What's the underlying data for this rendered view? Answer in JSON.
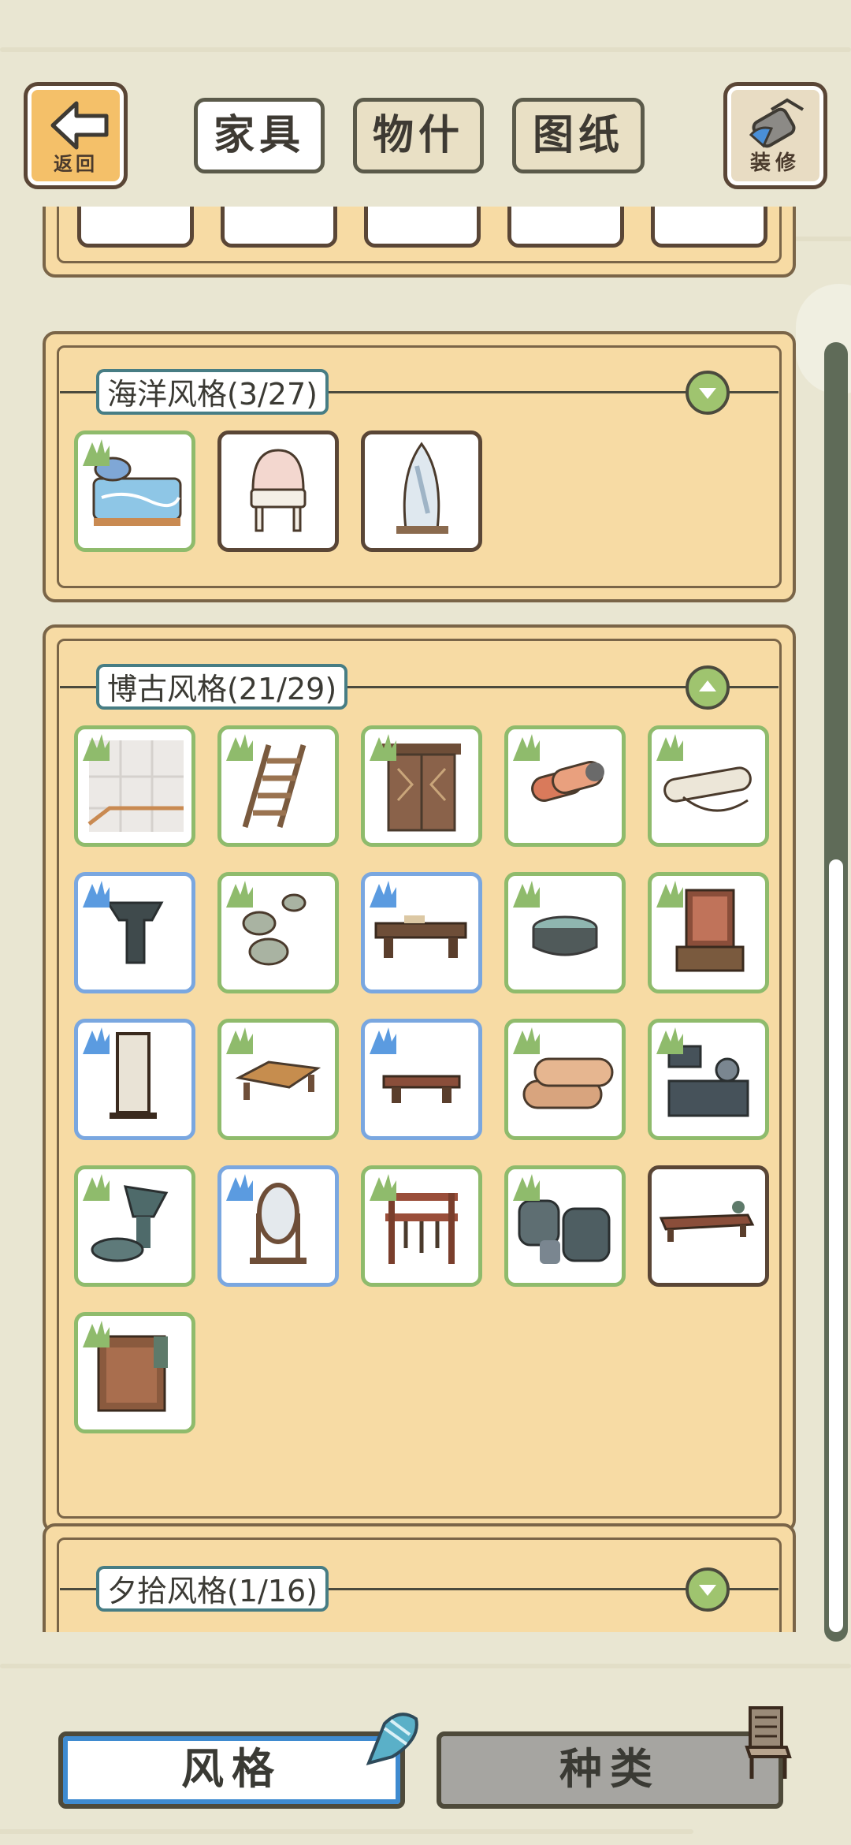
{
  "header": {
    "back_label": "返回",
    "tabs": [
      {
        "label": "家具",
        "state": "active"
      },
      {
        "label": "物什",
        "state": "inactive"
      },
      {
        "label": "图纸",
        "state": "inactive"
      }
    ],
    "decorate_label": "装修"
  },
  "sections": [
    {
      "title": "海洋风格(3/27)",
      "expanded": false,
      "items": [
        {
          "icon": "sea-bed-icon",
          "border": "green",
          "hand": true
        },
        {
          "icon": "shell-chair-icon",
          "border": "brown",
          "hand": false
        },
        {
          "icon": "surfboard-mirror-icon",
          "border": "brown",
          "hand": false
        }
      ]
    },
    {
      "title": "博古风格(21/29)",
      "expanded": true,
      "items": [
        {
          "icon": "tile-floor-icon",
          "border": "green",
          "hand": true
        },
        {
          "icon": "ladder-icon",
          "border": "green",
          "hand": true
        },
        {
          "icon": "wooden-door-icon",
          "border": "green",
          "hand": true
        },
        {
          "icon": "rolled-mat-icon",
          "border": "green",
          "hand": true
        },
        {
          "icon": "scroll-icon",
          "border": "green",
          "hand": true
        },
        {
          "icon": "stand-icon",
          "border": "blue",
          "hand": true
        },
        {
          "icon": "stepping-stones-icon",
          "border": "green",
          "hand": true
        },
        {
          "icon": "low-desk-icon",
          "border": "blue",
          "hand": true
        },
        {
          "icon": "basin-icon",
          "border": "green",
          "hand": true
        },
        {
          "icon": "cabinet-icon",
          "border": "green",
          "hand": true
        },
        {
          "icon": "screen-icon",
          "border": "blue",
          "hand": true
        },
        {
          "icon": "tea-table-icon",
          "border": "green",
          "hand": true
        },
        {
          "icon": "small-table-icon",
          "border": "blue",
          "hand": true
        },
        {
          "icon": "rolled-cushion-icon",
          "border": "green",
          "hand": true
        },
        {
          "icon": "stove-icon",
          "border": "green",
          "hand": true
        },
        {
          "icon": "bronze-vessel-icon",
          "border": "green",
          "hand": true
        },
        {
          "icon": "dressing-mirror-icon",
          "border": "blue",
          "hand": true
        },
        {
          "icon": "weapon-rack-icon",
          "border": "green",
          "hand": true
        },
        {
          "icon": "jars-icon",
          "border": "green",
          "hand": true
        },
        {
          "icon": "long-bench-icon",
          "border": "brown",
          "hand": false
        },
        {
          "icon": "wardrobe-icon",
          "border": "green",
          "hand": true
        }
      ]
    },
    {
      "title": "夕拾风格(1/16)",
      "expanded": false,
      "items": []
    }
  ],
  "bottom_tabs": [
    {
      "label": "风格",
      "state": "active"
    },
    {
      "label": "种类",
      "state": "inactive"
    }
  ],
  "colors": {
    "panel": "#f7dba4",
    "border_owned": "#8fbb6c",
    "border_placed": "#7aa7e0",
    "border_missing": "#5a4636",
    "toggle": "#9fc46f",
    "title_border": "#477d84"
  }
}
